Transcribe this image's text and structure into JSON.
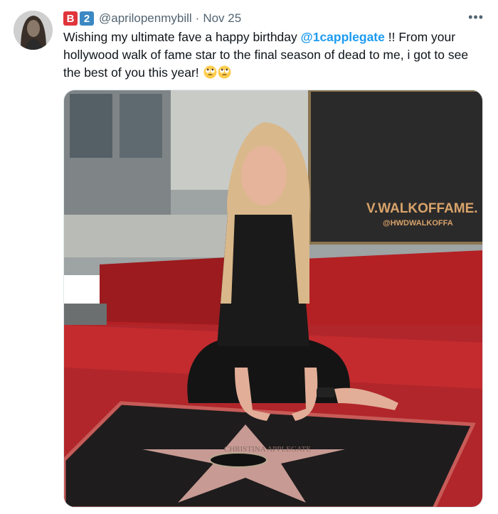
{
  "tweet": {
    "badges": [
      {
        "label": "B",
        "color": "#e0343a"
      },
      {
        "label": "2",
        "color": "#3b88c3"
      }
    ],
    "handle": "@aprilopenmybill",
    "separator": "·",
    "date": "Nov 25",
    "more_icon": "more-horizontal-icon",
    "text_before": "Wishing my ultimate fave a happy birthday ",
    "mention": "@1capplegate",
    "text_after": " !! From your hollywood walk of fame star to the final season of dead to me, i got to see the best of you this year! ",
    "emojis": [
      "face-with-rolling-eyes-emoji",
      "face-with-rolling-eyes-emoji"
    ]
  },
  "photo": {
    "sign_line1": "V.WALKOFFAME.",
    "sign_line2": "@HWDWALKOFFA",
    "star_engraving": "CHRISTINA APPLEGATE"
  },
  "colors": {
    "accent": "#1d9bf0",
    "secondary_text": "#536471",
    "carpet": "#b42124"
  }
}
